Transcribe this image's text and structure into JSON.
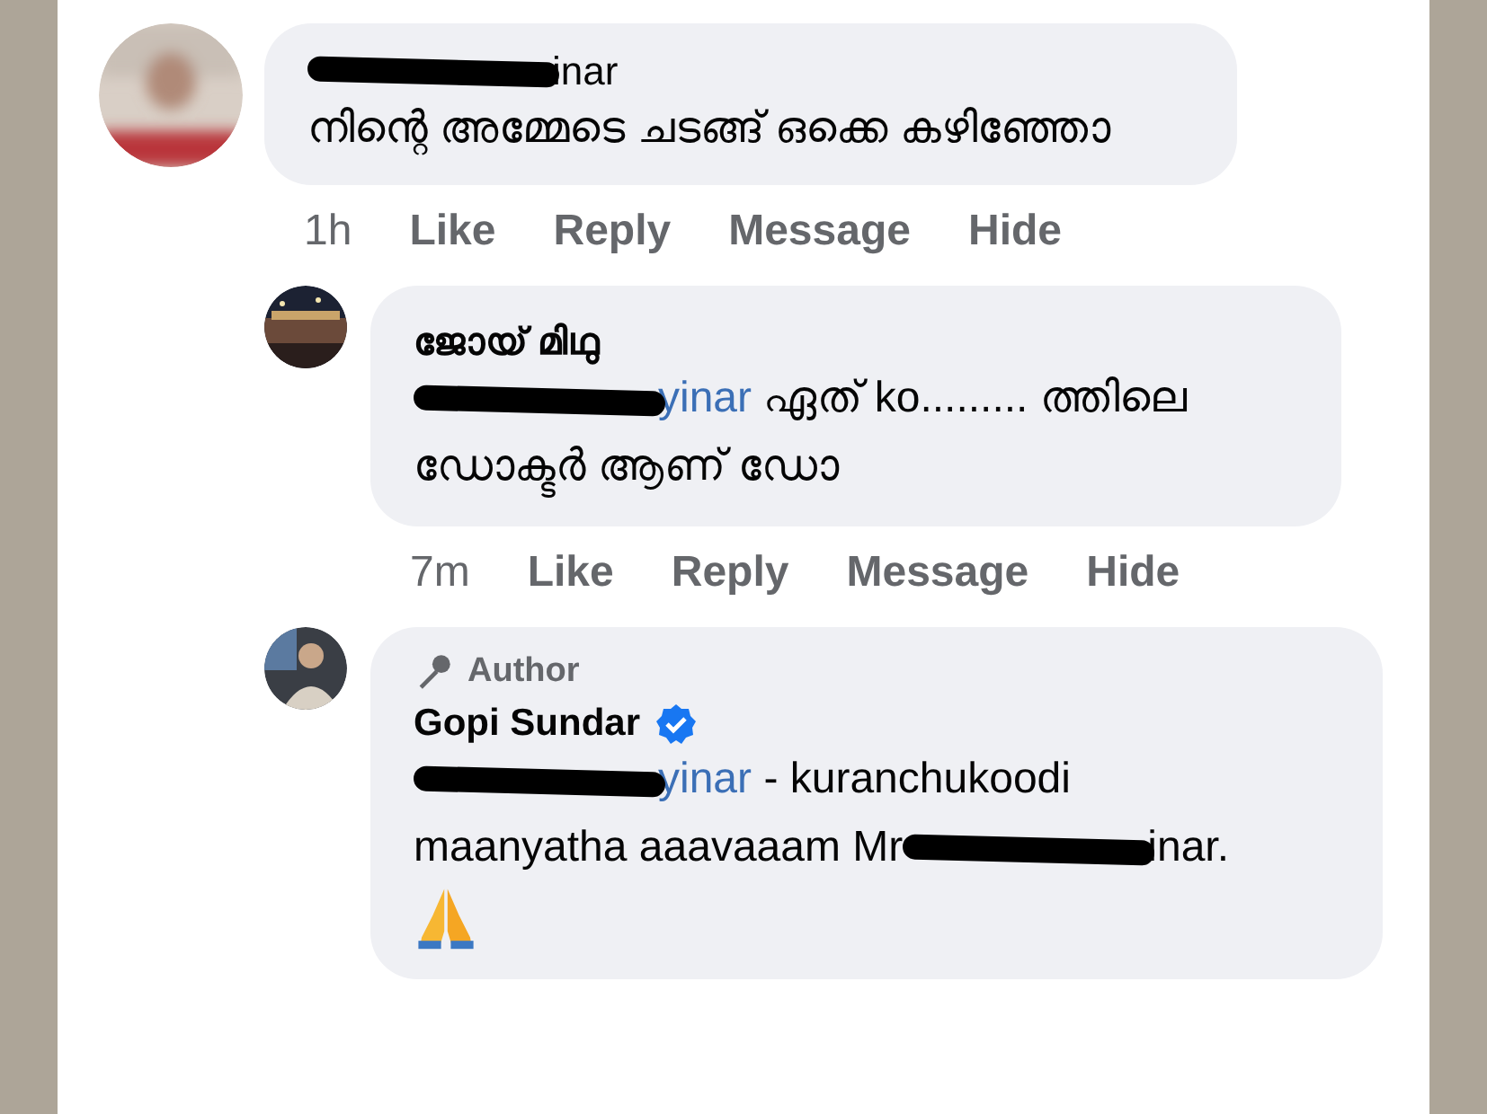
{
  "comments": [
    {
      "author": [
        {
          "kind": "redacted"
        },
        {
          "kind": "text",
          "text": "inar"
        }
      ],
      "body": [
        {
          "kind": "text",
          "text": "നിന്റെ അമ്മേടെ ചടങ്ങ് ഒക്കെ കഴിഞ്ഞോ"
        }
      ],
      "time": "1h",
      "actions": [
        "Like",
        "Reply",
        "Message",
        "Hide"
      ],
      "replies": [
        {
          "author": [
            {
              "kind": "text",
              "text": "ജോയ് മിഥു"
            }
          ],
          "body": [
            {
              "kind": "redacted"
            },
            {
              "kind": "mention",
              "text": "yinar"
            },
            {
              "kind": "text",
              "text": " ഏത് ko......... ത്തിലെ ഡോക്ടർ ആണ് ഡോ"
            }
          ],
          "time": "7m",
          "actions": [
            "Like",
            "Reply",
            "Message",
            "Hide"
          ]
        },
        {
          "role": "Author",
          "author": [
            {
              "kind": "text",
              "text": "Gopi Sundar"
            }
          ],
          "verified": true,
          "body": [
            {
              "kind": "redacted"
            },
            {
              "kind": "mention",
              "text": "yinar"
            },
            {
              "kind": "text",
              "text": " - kuranchukoodi maanyatha aaavaaam Mr"
            },
            {
              "kind": "redacted"
            },
            {
              "kind": "text",
              "text": "inar."
            },
            {
              "kind": "praying-hands"
            }
          ]
        }
      ]
    }
  ]
}
